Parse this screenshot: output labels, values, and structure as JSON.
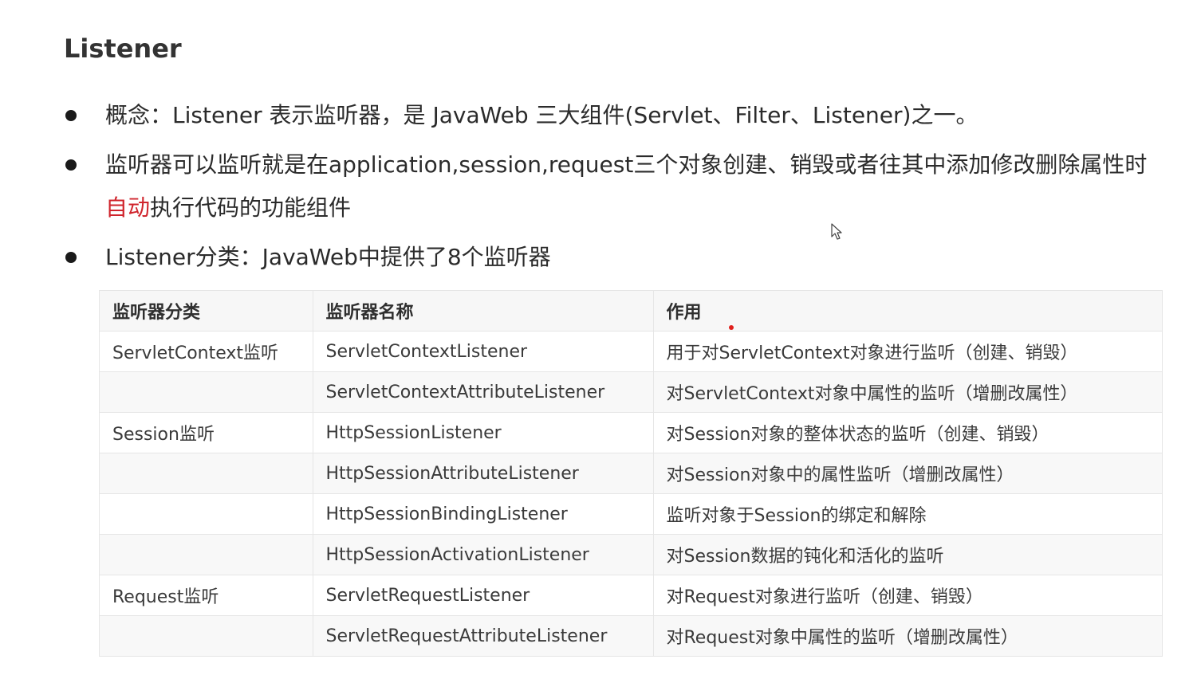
{
  "title": "Listener",
  "bullets": [
    {
      "text": "概念：Listener 表示监听器，是 JavaWeb 三大组件(Servlet、Filter、Listener)之一。"
    },
    {
      "text_before": "监听器可以监听就是在application,session,request三个对象创建、销毁或者往其中添加修改删除属性时",
      "text_highlight": "自动",
      "text_after": "执行代码的功能组件"
    },
    {
      "text": "Listener分类：JavaWeb中提供了8个监听器"
    }
  ],
  "colors": {
    "highlight": "#d0252d",
    "laser_dot": "#e0201c"
  },
  "icons": [
    "bullet-dot",
    "mouse-cursor-icon"
  ],
  "table": {
    "headers": [
      "监听器分类",
      "监听器名称",
      "作用"
    ],
    "rows": [
      [
        "ServletContext监听",
        "ServletContextListener",
        "用于对ServletContext对象进行监听（创建、销毁）"
      ],
      [
        "",
        "ServletContextAttributeListener",
        "对ServletContext对象中属性的监听（增删改属性）"
      ],
      [
        "Session监听",
        "HttpSessionListener",
        "对Session对象的整体状态的监听（创建、销毁）"
      ],
      [
        "",
        "HttpSessionAttributeListener",
        "对Session对象中的属性监听（增删改属性）"
      ],
      [
        "",
        "HttpSessionBindingListener",
        "监听对象于Session的绑定和解除"
      ],
      [
        "",
        "HttpSessionActivationListener",
        "对Session数据的钝化和活化的监听"
      ],
      [
        "Request监听",
        "ServletRequestListener",
        "对Request对象进行监听（创建、销毁）"
      ],
      [
        "",
        "ServletRequestAttributeListener",
        "对Request对象中属性的监听（增删改属性）"
      ]
    ]
  }
}
